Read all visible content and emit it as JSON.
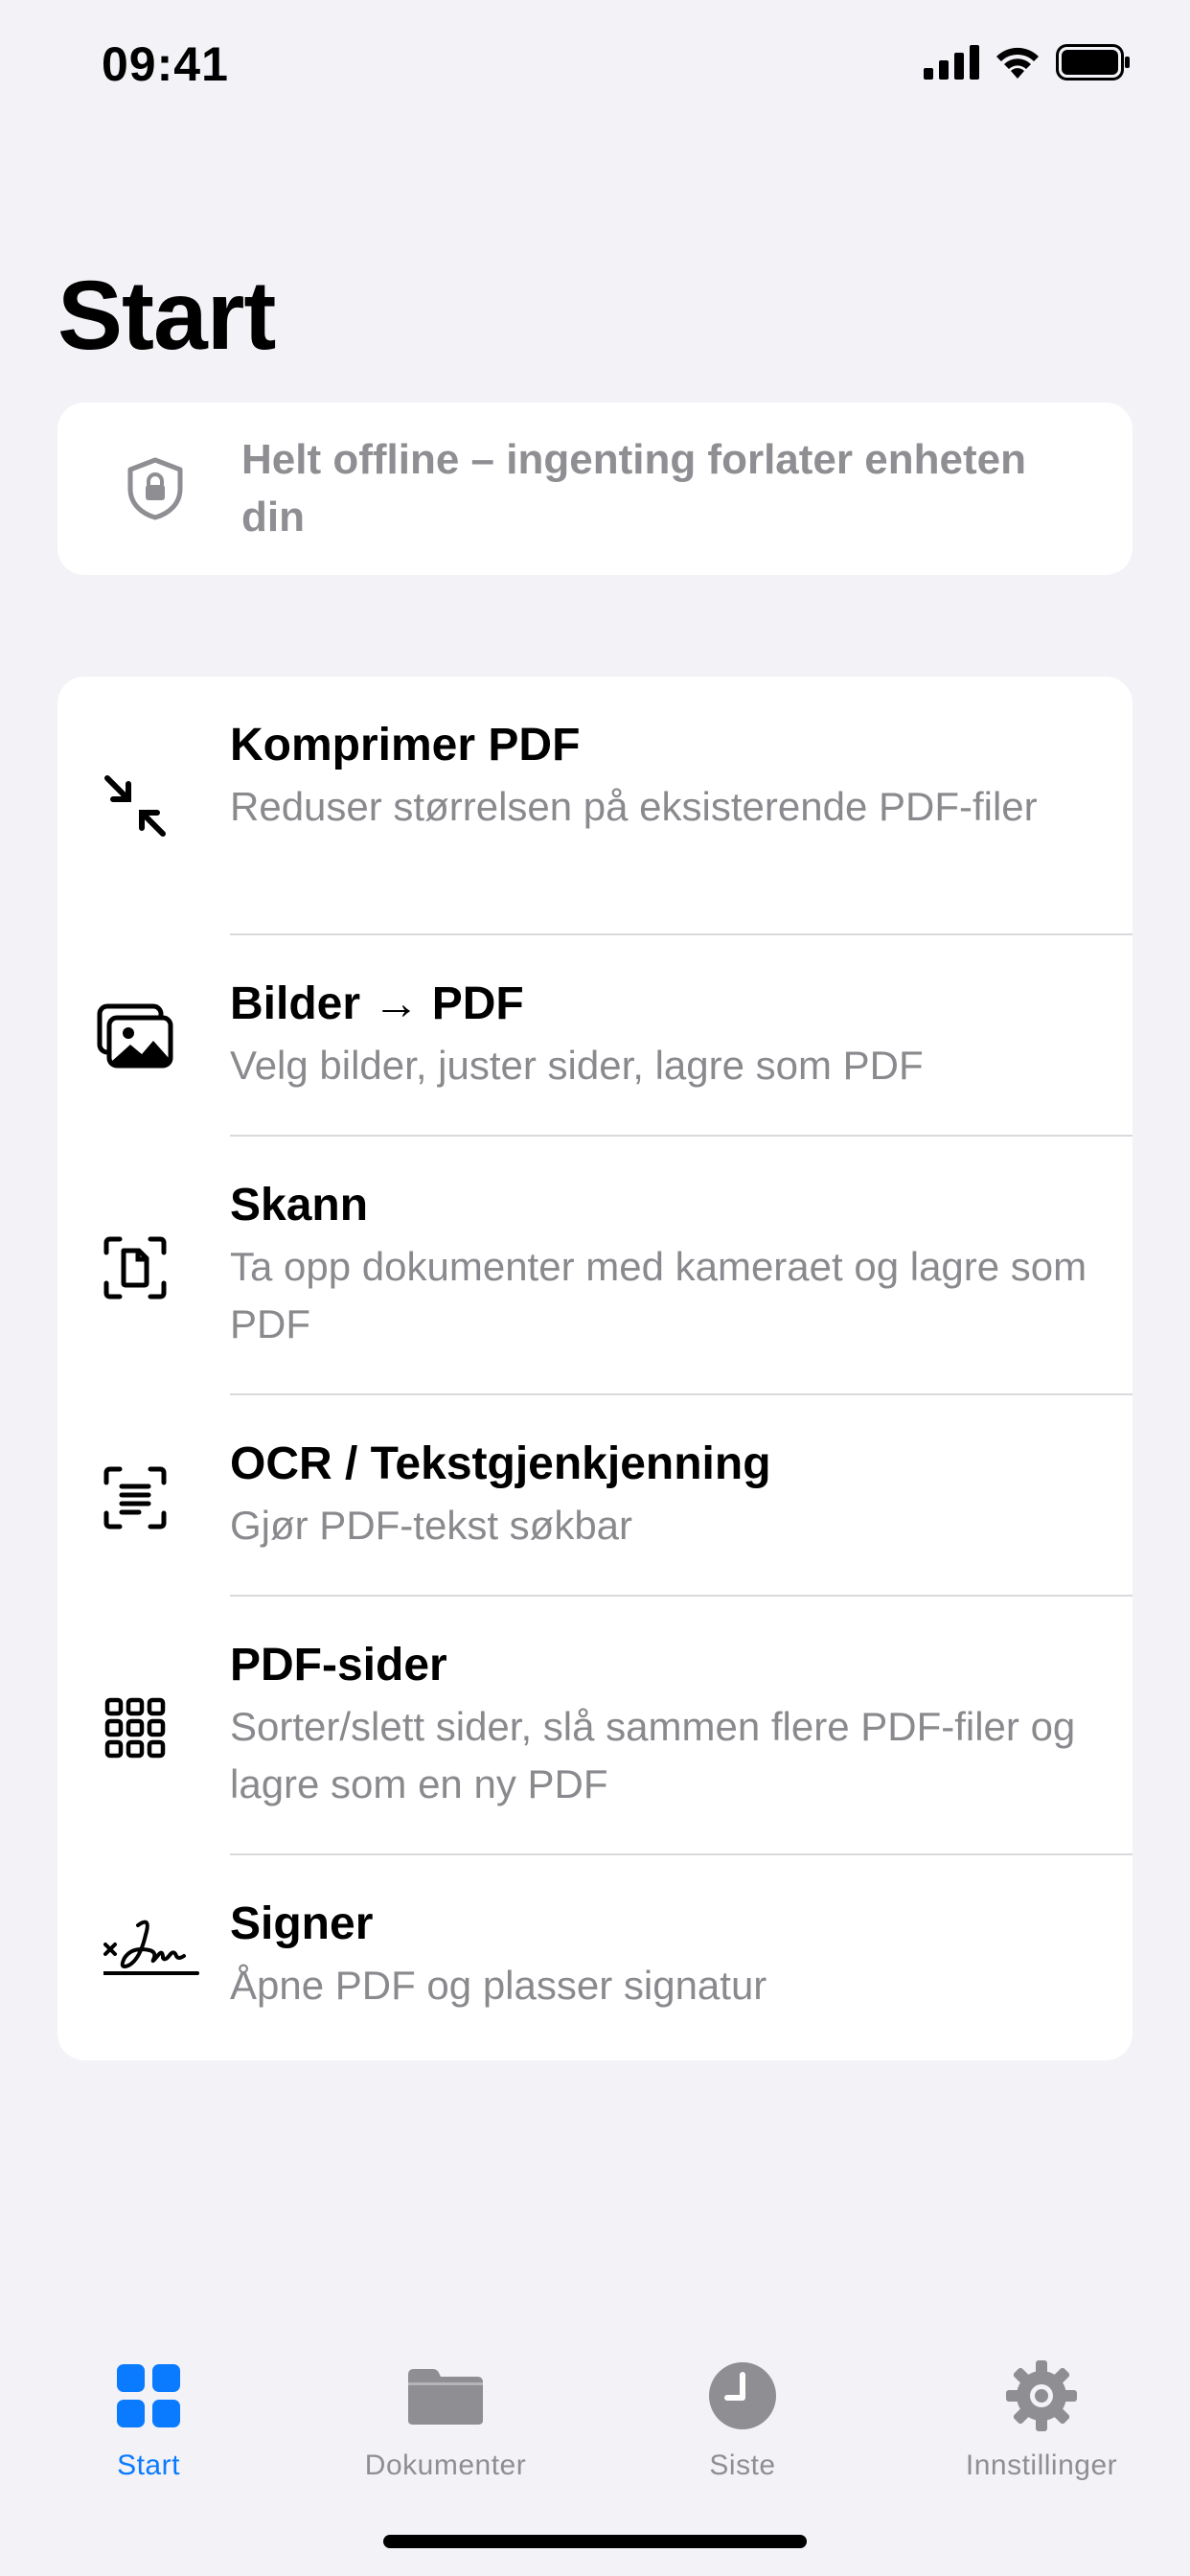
{
  "status_bar": {
    "time": "09:41"
  },
  "page": {
    "title": "Start"
  },
  "banner": {
    "icon": "shield-lock-icon",
    "text": "Helt offline – ingenting forlater enheten din"
  },
  "features": [
    {
      "icon": "compress-arrows-icon",
      "title": "Komprimer PDF",
      "subtitle": "Reduser størrelsen på eksisterende PDF-filer"
    },
    {
      "icon": "photos-icon",
      "title": "Bilder → PDF",
      "subtitle": "Velg bilder, juster sider, lagre som PDF"
    },
    {
      "icon": "document-scan-icon",
      "title": "Skann",
      "subtitle": "Ta opp dokumenter med kameraet og lagre som PDF"
    },
    {
      "icon": "text-viewfinder-icon",
      "title": "OCR / Tekstgjenkjenning",
      "subtitle": "Gjør PDF-tekst søkbar"
    },
    {
      "icon": "grid-pages-icon",
      "title": "PDF-sider",
      "subtitle": "Sorter/slett sider, slå sammen flere PDF-filer og lagre som en ny PDF"
    },
    {
      "icon": "signature-icon",
      "title": "Signer",
      "subtitle": "Åpne PDF og plasser signatur"
    }
  ],
  "tab_bar": {
    "tabs": [
      {
        "label": "Start",
        "icon": "grid-icon",
        "active": true
      },
      {
        "label": "Dokumenter",
        "icon": "folder-icon",
        "active": false
      },
      {
        "label": "Siste",
        "icon": "clock-icon",
        "active": false
      },
      {
        "label": "Innstillinger",
        "icon": "gear-icon",
        "active": false
      }
    ]
  },
  "colors": {
    "accent": "#0A7AFF",
    "background": "#F2F2F7",
    "secondary_text": "#8E8E93"
  }
}
